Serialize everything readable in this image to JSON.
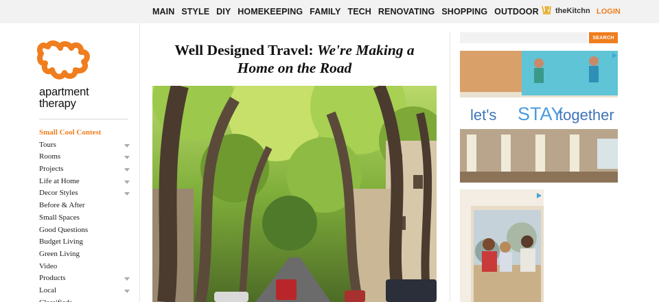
{
  "nav": {
    "items": [
      "MAIN",
      "STYLE",
      "DIY",
      "HOMEKEEPING",
      "FAMILY",
      "TECH",
      "RENOVATING",
      "SHOPPING",
      "OUTDOOR"
    ],
    "partner_label": "theKitchn",
    "login_label": "LOGIN"
  },
  "logo": {
    "line1": "apartment",
    "line2": "therapy"
  },
  "sidebar": {
    "items": [
      {
        "label": "Small Cool Contest",
        "highlight": true,
        "arrow": false
      },
      {
        "label": "Tours",
        "highlight": false,
        "arrow": true
      },
      {
        "label": "Rooms",
        "highlight": false,
        "arrow": true
      },
      {
        "label": "Projects",
        "highlight": false,
        "arrow": true
      },
      {
        "label": "Life at Home",
        "highlight": false,
        "arrow": true
      },
      {
        "label": "Decor Styles",
        "highlight": false,
        "arrow": true
      },
      {
        "label": "Before & After",
        "highlight": false,
        "arrow": false
      },
      {
        "label": "Small Spaces",
        "highlight": false,
        "arrow": false
      },
      {
        "label": "Good Questions",
        "highlight": false,
        "arrow": false
      },
      {
        "label": "Budget Living",
        "highlight": false,
        "arrow": false
      },
      {
        "label": "Green Living",
        "highlight": false,
        "arrow": false
      },
      {
        "label": "Video",
        "highlight": false,
        "arrow": false
      },
      {
        "label": "Products",
        "highlight": false,
        "arrow": true
      },
      {
        "label": "Local",
        "highlight": false,
        "arrow": true
      },
      {
        "label": "Classifieds",
        "highlight": false,
        "arrow": false
      }
    ]
  },
  "article": {
    "title_plain": "Well Designed Travel: ",
    "title_italic_1": "We're Making a",
    "title_italic_2": "Home on the Road"
  },
  "search": {
    "button_label": "SEARCH"
  },
  "ad1": {
    "text_a": "let's",
    "text_b": "STAY",
    "text_c": "together"
  },
  "colors": {
    "accent": "#f07d1e",
    "ad_blue": "#3f74b8"
  }
}
